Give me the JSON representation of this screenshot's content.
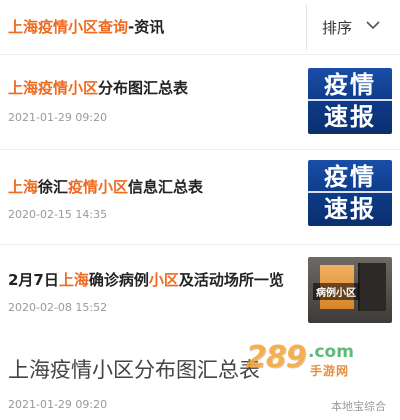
{
  "header": {
    "title_highlight": "上海疫情小区查询",
    "title_rest": "-资讯",
    "sort_label": "排序",
    "sort_icon": "chevron-down-icon"
  },
  "articles": [
    {
      "title_parts": [
        {
          "text": "上海疫情小区",
          "highlight": true
        },
        {
          "text": "分布图汇总表",
          "highlight": false
        }
      ],
      "date": "2021-01-29 09:20",
      "thumb": {
        "line1": "疫情",
        "line2": "速报"
      }
    },
    {
      "title_parts": [
        {
          "text": "上海",
          "highlight": true
        },
        {
          "text": "徐汇",
          "highlight": false
        },
        {
          "text": "疫情小区",
          "highlight": true
        },
        {
          "text": "信息汇总表",
          "highlight": false
        }
      ],
      "date": "2020-02-15 14:35",
      "thumb": {
        "line1": "疫情",
        "line2": "速报"
      }
    },
    {
      "title_parts": [
        {
          "text": "2月7日",
          "highlight": false
        },
        {
          "text": "上海",
          "highlight": true
        },
        {
          "text": "确诊病例",
          "highlight": false
        },
        {
          "text": "小区",
          "highlight": true
        },
        {
          "text": "及活动场所一览",
          "highlight": false
        }
      ],
      "date": "2020-02-08 15:52",
      "thumb": {
        "caption": "病例小区"
      }
    }
  ],
  "featured": {
    "title": "上海疫情小区分布图汇总表",
    "date": "2021-01-29 09:20",
    "source": "本地宝综合"
  },
  "watermark": {
    "number": "289",
    "domain": ".com",
    "subtitle": "手游网"
  },
  "colors": {
    "highlight": "#ee6a20",
    "thumb_blue": "#1a4ea8"
  }
}
